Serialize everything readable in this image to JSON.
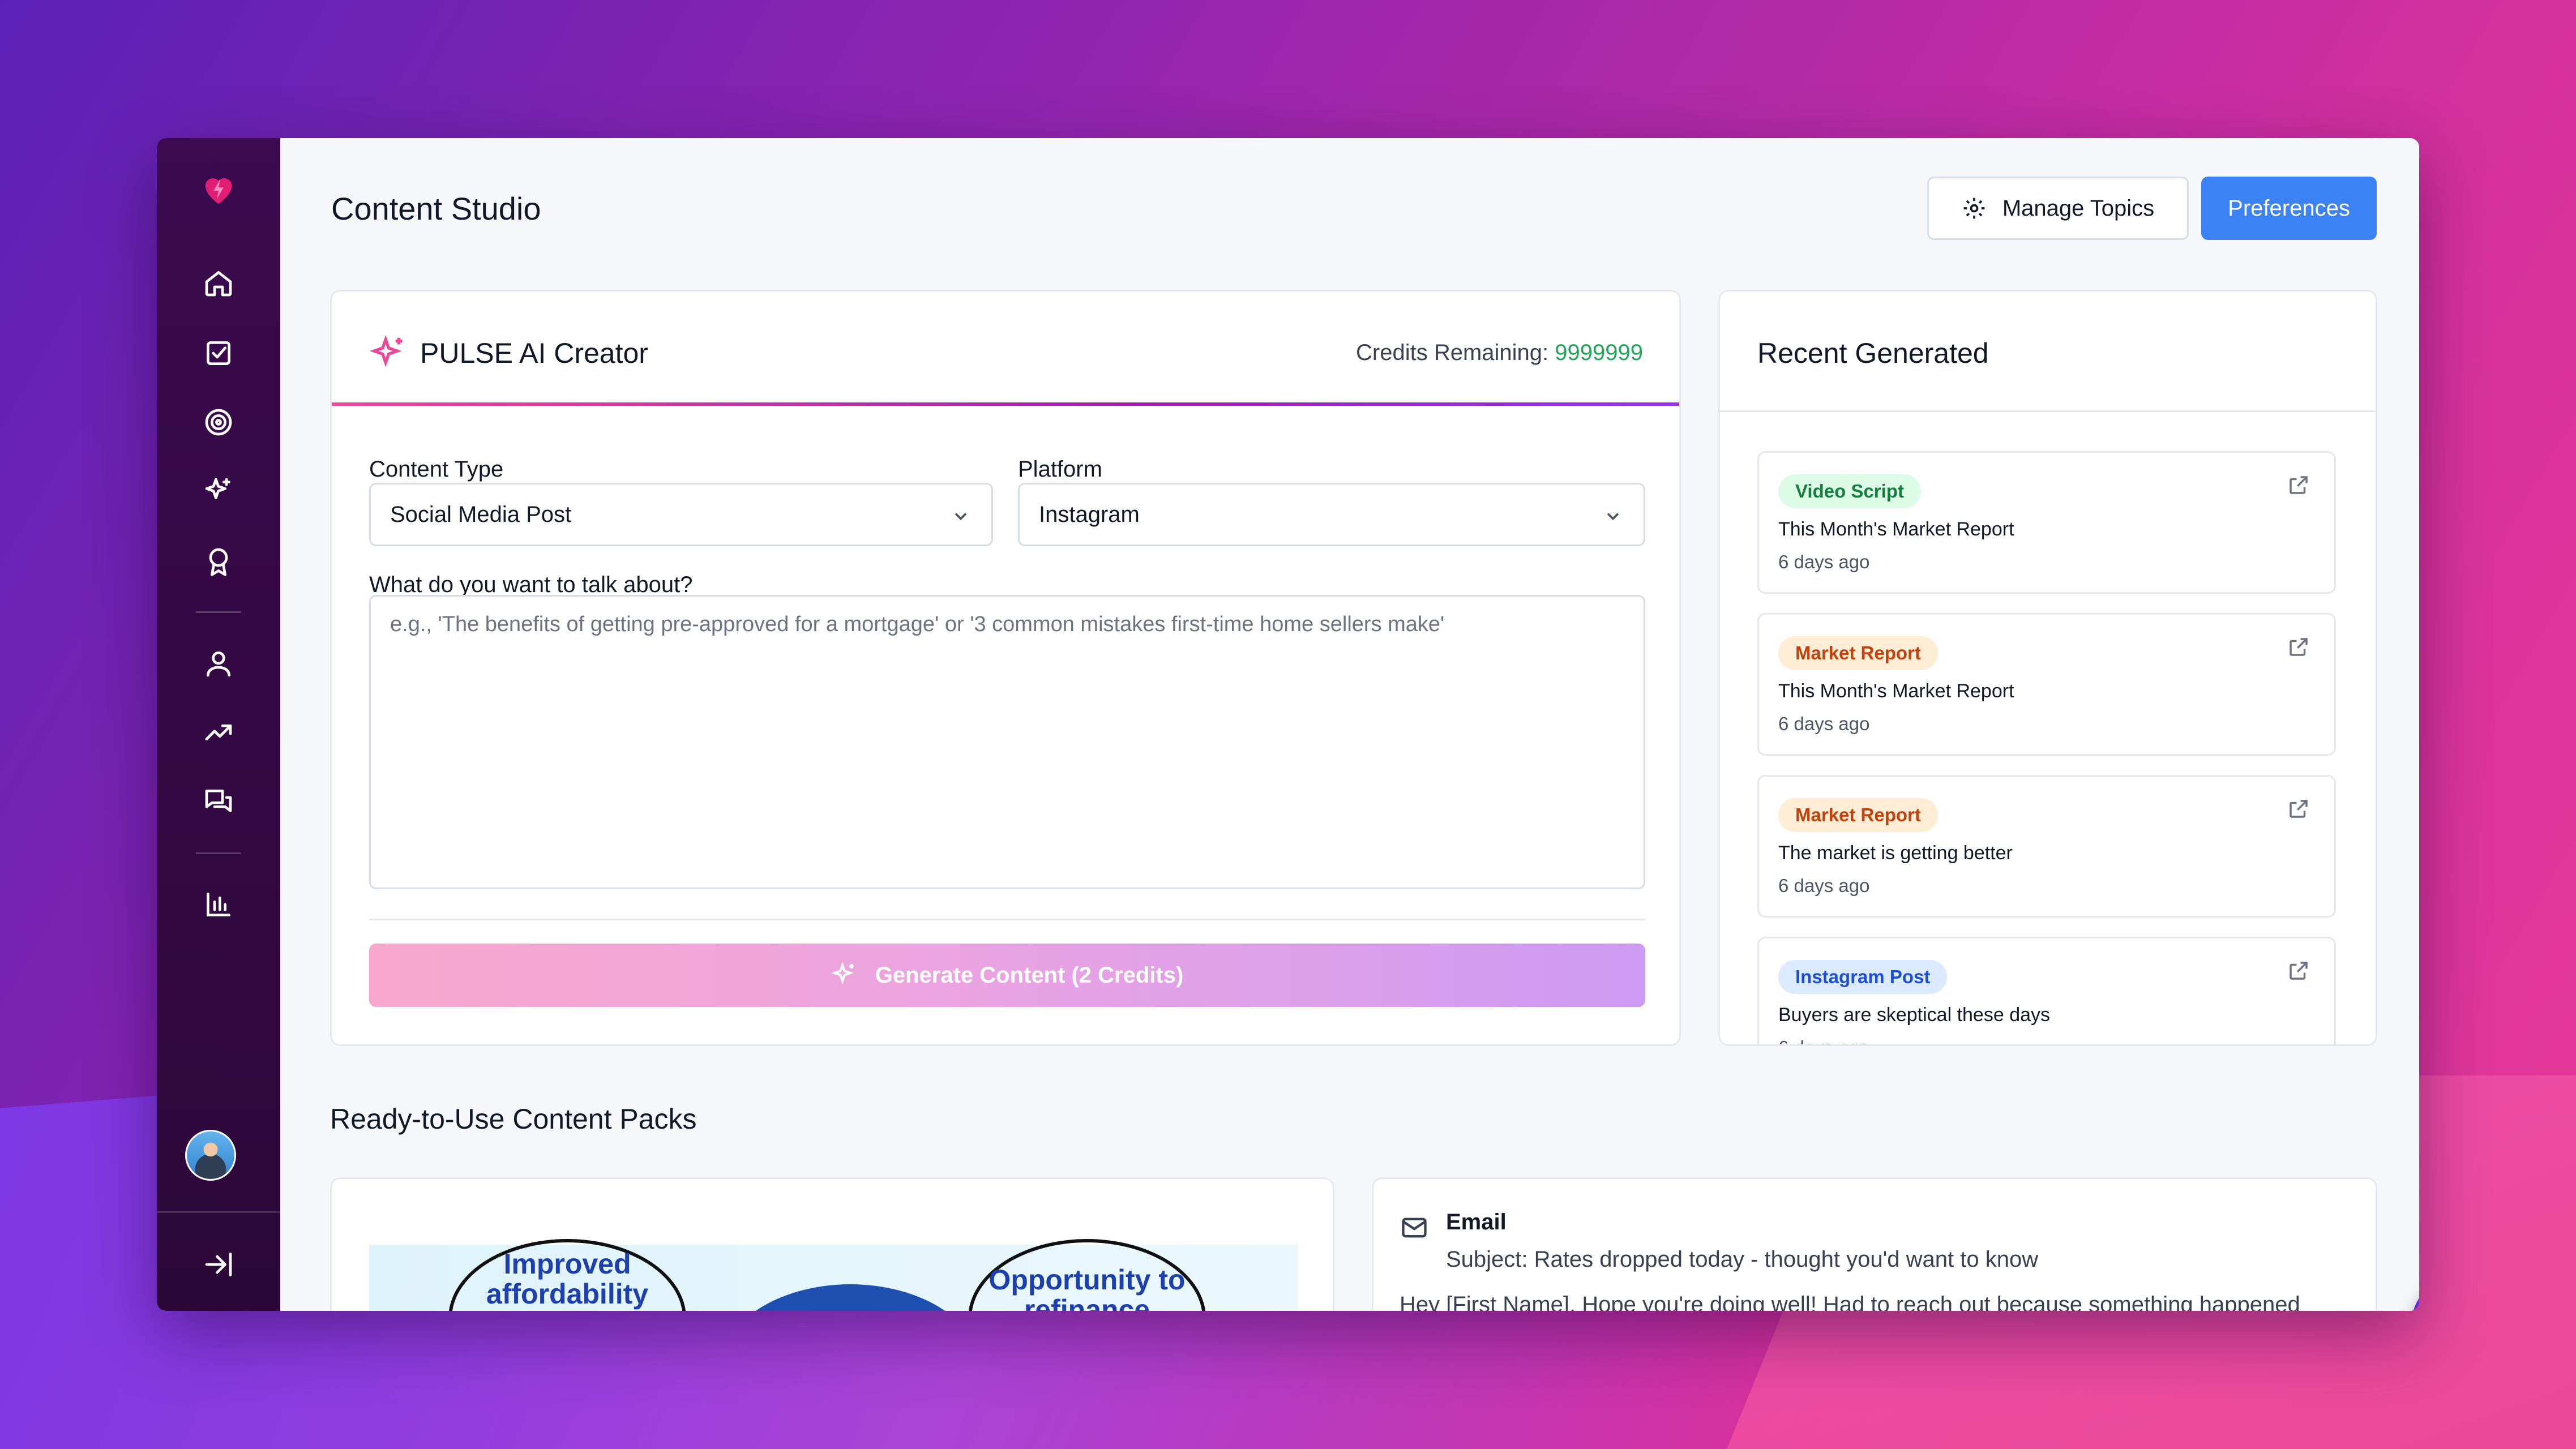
{
  "header": {
    "title": "Content Studio",
    "manage_topics_label": "Manage Topics",
    "preferences_label": "Preferences"
  },
  "creator": {
    "title": "PULSE AI Creator",
    "credits_label": "Credits Remaining: ",
    "credits_value": "9999999",
    "content_type_label": "Content Type",
    "content_type_value": "Social Media Post",
    "platform_label": "Platform",
    "platform_value": "Instagram",
    "topic_label": "What do you want to talk about?",
    "topic_placeholder": "e.g., 'The benefits of getting pre-approved for a mortgage' or '3 common mistakes first-time home sellers make'",
    "generate_label": "Generate Content (2 Credits)"
  },
  "recent": {
    "title": "Recent Generated",
    "items": [
      {
        "badge": "Video Script",
        "title": "This Month's Market Report",
        "time": "6 days ago"
      },
      {
        "badge": "Market Report",
        "title": "This Month's Market Report",
        "time": "6 days ago"
      },
      {
        "badge": "Market Report",
        "title": "The market is getting better",
        "time": "6 days ago"
      },
      {
        "badge": "Instagram Post",
        "title": "Buyers are skeptical these days",
        "time": "6 days ago"
      }
    ]
  },
  "packs": {
    "title": "Ready-to-Use Content Packs",
    "image_pack": {
      "bubble_left": "Improved affordability",
      "bubble_right": "Opportunity to refinance"
    },
    "email_pack": {
      "type": "Email",
      "subject": "Subject: Rates dropped today - thought you'd want to know",
      "body": "Hey [First Name], Hope you're doing well! Had to reach out because something happened"
    }
  },
  "colors": {
    "accent": "#3b82f6",
    "credits_green": "#22a55a",
    "sidebar": "#3b0a4f",
    "chat_fab": "#6d28d9"
  }
}
